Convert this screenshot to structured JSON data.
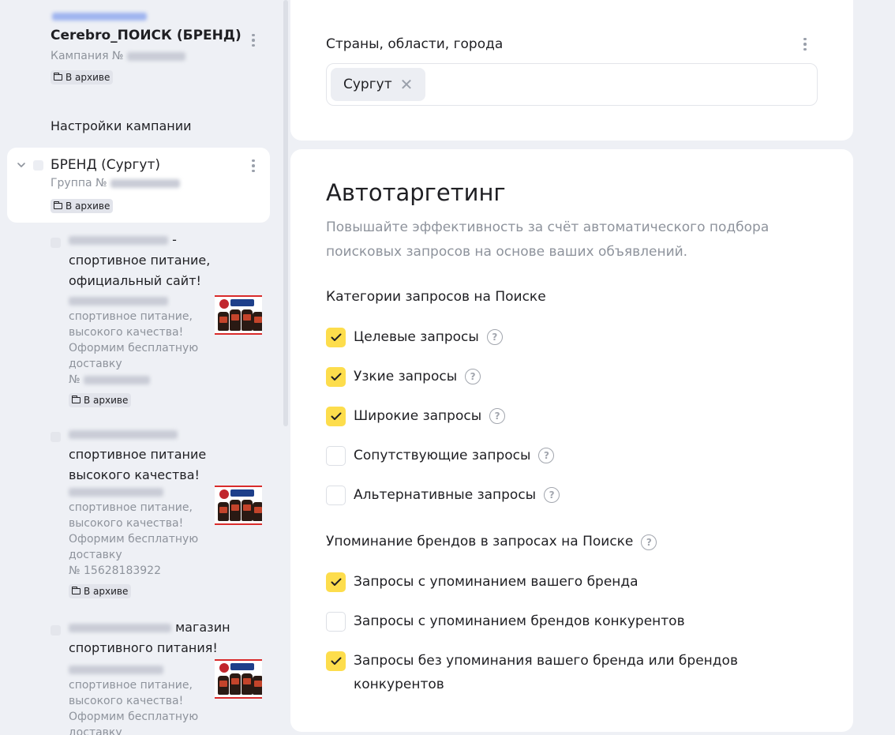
{
  "sidebar": {
    "campaign": {
      "title": "Cerebro_ПОИСК (БРЕНД)",
      "sub_label": "Кампания №",
      "badge": "В архиве"
    },
    "settings_link": "Настройки кампании",
    "group": {
      "title": "БРЕНД (Сургут)",
      "sub_label": "Группа №",
      "badge": "В архиве"
    },
    "ads": [
      {
        "title": "- спортивное питание, официальный сайт!",
        "desc_lines": [
          "спортивное питание,",
          "высокого качества!",
          "Оформим бесплатную",
          "доставку"
        ],
        "number_label": "№",
        "badge": "В архиве"
      },
      {
        "title": "спортивное питание высокого качества!",
        "desc_lines": [
          "спортивное питание,",
          "высокого качества!",
          "Оформим бесплатную",
          "доставку"
        ],
        "number_label": "№ 15628183922",
        "badge": "В архиве"
      },
      {
        "title": "магазин спортивного питания!",
        "desc_lines": [
          "спортивное питание,",
          "высокого качества!",
          "Оформим бесплатную",
          "доставку"
        ]
      }
    ]
  },
  "regions": {
    "label": "Страны, области, города",
    "chips": [
      "Сургут"
    ]
  },
  "autotargeting": {
    "title": "Автотаргетинг",
    "description": "Повышайте эффективность за счёт автоматического подбора поисковых запросов на основе ваших объявлений.",
    "categories_title": "Категории запросов на Поиске",
    "categories": [
      {
        "label": "Целевые запросы",
        "checked": true
      },
      {
        "label": "Узкие запросы",
        "checked": true
      },
      {
        "label": "Широкие запросы",
        "checked": true
      },
      {
        "label": "Сопутствующие запросы",
        "checked": false
      },
      {
        "label": "Альтернативные запросы",
        "checked": false
      }
    ],
    "brands_title": "Упоминание брендов в запросах на Поиске",
    "brands": [
      {
        "label": "Запросы с упоминанием вашего бренда",
        "checked": true
      },
      {
        "label": "Запросы с упоминанием брендов конкурентов",
        "checked": false
      },
      {
        "label": "Запросы без упоминания вашего бренда или брендов конкурентов",
        "checked": true
      }
    ]
  },
  "colors": {
    "checkbox_checked": "#fddd4c",
    "page_bg": "#eef0f5",
    "card_bg": "#ffffff",
    "muted_text": "#8e939c"
  }
}
